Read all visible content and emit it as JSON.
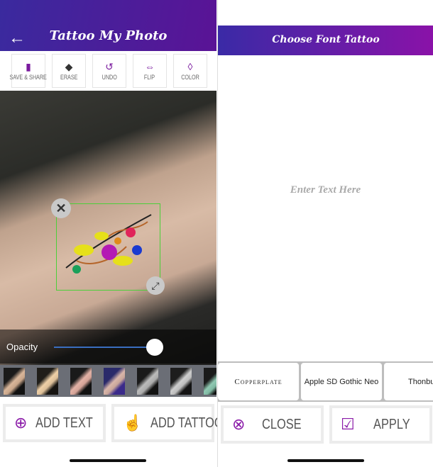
{
  "left": {
    "title": "Tattoo My Photo",
    "back_icon": "arrow-left-icon",
    "tools": [
      {
        "label": "SAVE & SHARE",
        "icon": "sd-card-icon"
      },
      {
        "label": "ERASE",
        "icon": "eraser-icon"
      },
      {
        "label": "UNDO",
        "icon": "undo-icon"
      },
      {
        "label": "FLIP",
        "icon": "flip-icon"
      },
      {
        "label": "COLOR",
        "icon": "droplet-icon"
      }
    ],
    "opacity": {
      "label": "Opacity",
      "value": 1.0
    },
    "buttons": {
      "add_text": "ADD TEXT",
      "add_tattoo": "ADD TATTOO"
    }
  },
  "right": {
    "title": "Choose Font Tattoo",
    "placeholder": "Enter Text Here",
    "fonts": [
      "Copperplate",
      "Apple SD Gothic Neo",
      "Thonbu"
    ],
    "buttons": {
      "close": "CLOSE",
      "apply": "APPLY"
    }
  },
  "colors": {
    "accent": "#7a1a9e",
    "header_start": "#3a2a9e",
    "header_end": "#5a1396",
    "selection": "#4ccf3a"
  }
}
